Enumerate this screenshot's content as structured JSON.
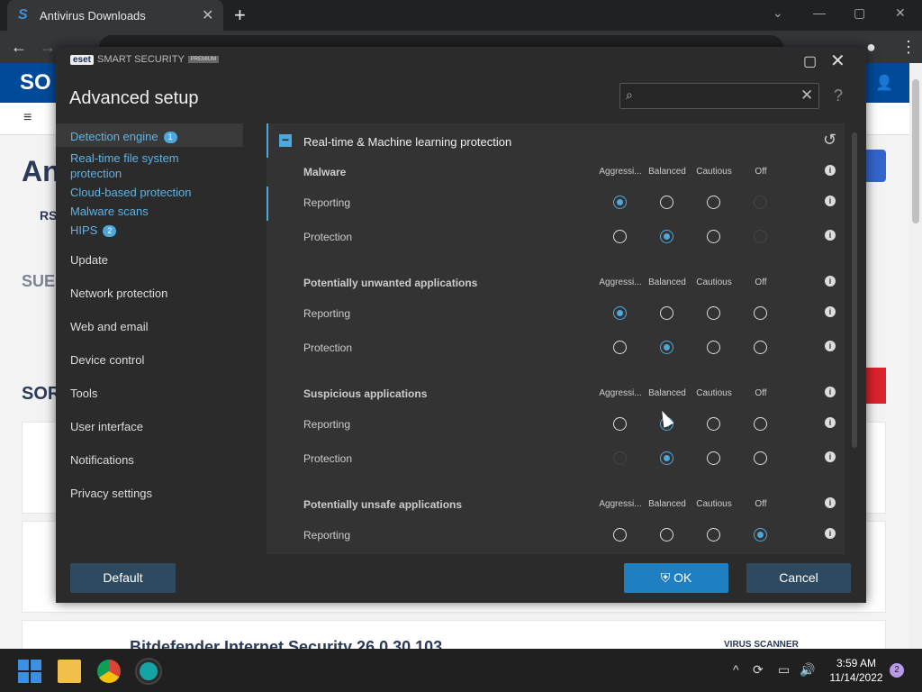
{
  "browser": {
    "tab_title": "Antivirus Downloads",
    "favicon": "S",
    "new_tab": "+",
    "close_tab": "✕",
    "win_min": "—",
    "win_max": "▢",
    "win_close": "✕",
    "win_dropdown": "⌄"
  },
  "page": {
    "logo": "SO",
    "title_partial": "An",
    "rss_partial": "RS",
    "sub_partial": "SUE",
    "sor_partial": "SOR",
    "bottom_title": "Bitdefender Internet Security 26.0.30.103",
    "virus_scanner": "VIRUS SCANNER"
  },
  "eset": {
    "brand_badge": "eset",
    "brand_name": "SMART SECURITY",
    "brand_premium": "PREMIUM",
    "heading": "Advanced setup",
    "search_placeholder": "",
    "help": "?",
    "nav": [
      {
        "label": "Detection engine",
        "badge": "1"
      },
      {
        "label": "Real-time file system protection"
      },
      {
        "label": "Cloud-based protection"
      },
      {
        "label": "Malware scans"
      },
      {
        "label": "HIPS",
        "badge": "2"
      },
      {
        "label": "Update"
      },
      {
        "label": "Network protection"
      },
      {
        "label": "Web and email"
      },
      {
        "label": "Device control"
      },
      {
        "label": "Tools"
      },
      {
        "label": "User interface"
      },
      {
        "label": "Notifications"
      },
      {
        "label": "Privacy settings"
      }
    ],
    "section_title": "Real-time & Machine learning protection",
    "levels": [
      "Aggressi...",
      "Balanced",
      "Cautious",
      "Off"
    ],
    "groups": [
      {
        "name": "Malware",
        "rows": [
          {
            "label": "Reporting",
            "selected": 0,
            "disabled": [
              3
            ]
          },
          {
            "label": "Protection",
            "selected": 1,
            "disabled": [
              3
            ]
          }
        ]
      },
      {
        "name": "Potentially unwanted applications",
        "rows": [
          {
            "label": "Reporting",
            "selected": 0,
            "disabled": []
          },
          {
            "label": "Protection",
            "selected": 1,
            "disabled": []
          }
        ]
      },
      {
        "name": "Suspicious applications",
        "rows": [
          {
            "label": "Reporting",
            "selected": 1,
            "disabled": []
          },
          {
            "label": "Protection",
            "selected": 1,
            "disabled": [
              0
            ]
          }
        ]
      },
      {
        "name": "Potentially unsafe applications",
        "rows": [
          {
            "label": "Reporting",
            "selected": 3,
            "disabled": []
          }
        ]
      }
    ],
    "btn_default": "Default",
    "btn_ok": "OK",
    "btn_cancel": "Cancel"
  },
  "taskbar": {
    "time": "3:59 AM",
    "date": "11/14/2022",
    "notifications": "2"
  },
  "colors": {
    "accent": "#4ea8de",
    "ok": "#1f7fc0"
  }
}
